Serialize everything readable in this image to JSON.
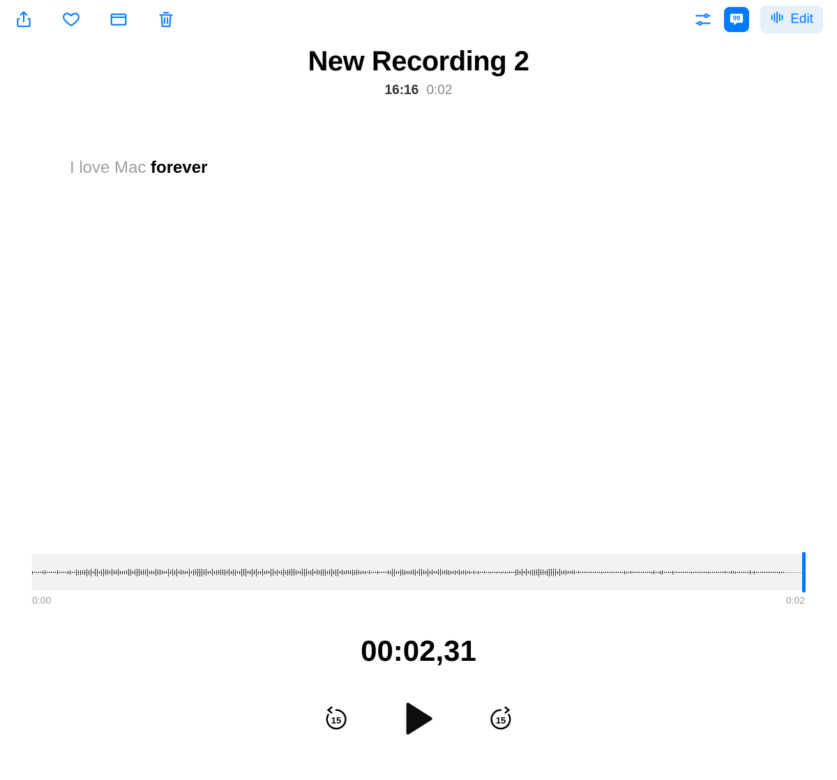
{
  "toolbar": {
    "edit_label": "Edit"
  },
  "header": {
    "title": "New Recording 2",
    "time": "16:16",
    "duration": "0:02"
  },
  "transcript": {
    "dim_text": "I love Mac ",
    "highlight_text": "forever"
  },
  "waveform": {
    "start_label": "0:00",
    "end_label": "0:02"
  },
  "playback": {
    "current_time": "00:02,31",
    "skip_back_label": "15",
    "skip_forward_label": "15"
  }
}
